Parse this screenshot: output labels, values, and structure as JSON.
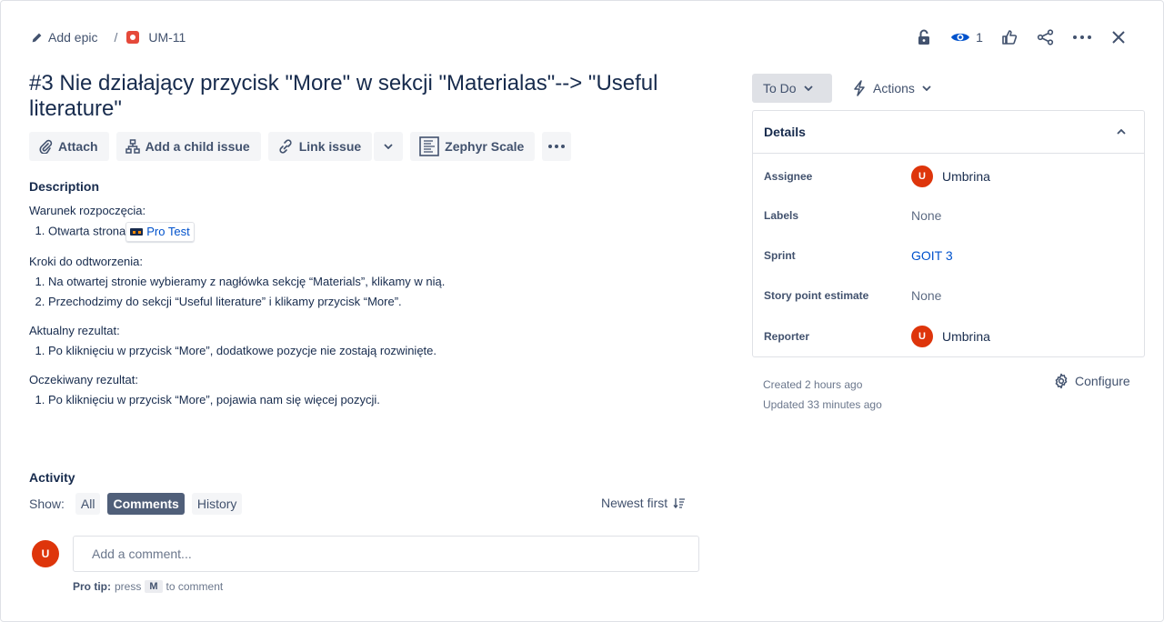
{
  "breadcrumb": {
    "add_epic": "Add epic",
    "separator": "/",
    "issue_key": "UM-11"
  },
  "top_actions": {
    "watch_count": "1"
  },
  "issue": {
    "title": "#3 Nie działający przycisk \"More\" w sekcji \"Materialas\"--> \"Useful literature\""
  },
  "toolbar": {
    "attach": "Attach",
    "add_child": "Add a child issue",
    "link_issue": "Link issue",
    "zephyr": "Zephyr Scale"
  },
  "description": {
    "heading": "Description",
    "start_condition_label": "Warunek rozpoczęcia:",
    "start_item_text": "Otwarta strona",
    "start_item_link": "Pro Test",
    "steps_label": "Kroki do odtworzenia:",
    "steps": [
      "Na otwartej stronie wybieramy z nagłówka sekcję “Materials”, klikamy w nią.",
      "Przechodzimy do sekcji “Useful literature” i klikamy przycisk “More”."
    ],
    "actual_label": "Aktualny rezultat:",
    "actual": [
      "Po kliknięciu w przycisk “More”, dodatkowe pozycje nie zostają rozwinięte."
    ],
    "expected_label": "Oczekiwany rezultat:",
    "expected": [
      "Po kliknięciu w przycisk “More”, pojawia nam się więcej pozycji."
    ]
  },
  "activity": {
    "heading": "Activity",
    "show_label": "Show:",
    "filters": [
      "All",
      "Comments",
      "History"
    ],
    "active_filter": "Comments",
    "sort": "Newest first",
    "comment_placeholder": "Add a comment...",
    "user_initial": "U",
    "protip_bold": "Pro tip:",
    "protip_press": "press",
    "protip_key": "M",
    "protip_rest": "to comment"
  },
  "status": {
    "label": "To Do"
  },
  "actions": {
    "label": "Actions"
  },
  "details": {
    "heading": "Details",
    "rows": {
      "assignee": {
        "label": "Assignee",
        "value": "Umbrina",
        "initial": "U"
      },
      "labels": {
        "label": "Labels",
        "value": "None"
      },
      "sprint": {
        "label": "Sprint",
        "value": "GOIT 3"
      },
      "story_points": {
        "label": "Story point estimate",
        "value": "None"
      },
      "reporter": {
        "label": "Reporter",
        "value": "Umbrina",
        "initial": "U"
      }
    }
  },
  "meta": {
    "created": "Created 2 hours ago",
    "updated": "Updated 33 minutes ago",
    "configure": "Configure"
  },
  "colors": {
    "avatar": "#de350b",
    "link": "#0052cc",
    "text": "#172b4d",
    "active_chip": "#505f79",
    "issue_type": "#e5493a"
  }
}
